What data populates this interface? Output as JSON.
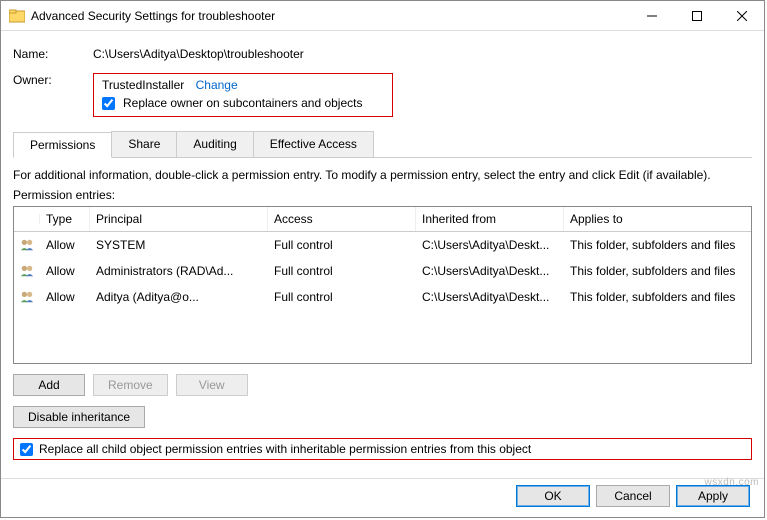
{
  "window": {
    "title": "Advanced Security Settings for troubleshooter"
  },
  "fields": {
    "nameLabel": "Name:",
    "nameValue": "C:\\Users\\Aditya\\Desktop\\troubleshooter",
    "ownerLabel": "Owner:",
    "ownerValue": "TrustedInstaller",
    "changeLink": "Change",
    "replaceOwnerCheckbox": "Replace owner on subcontainers and objects"
  },
  "tabs": {
    "permissions": "Permissions",
    "share": "Share",
    "auditing": "Auditing",
    "effective": "Effective Access"
  },
  "info": "For additional information, double-click a permission entry. To modify a permission entry, select the entry and click Edit (if available).",
  "entriesLabel": "Permission entries:",
  "headers": {
    "type": "Type",
    "principal": "Principal",
    "access": "Access",
    "inherited": "Inherited from",
    "applies": "Applies to"
  },
  "rows": [
    {
      "type": "Allow",
      "principal": "SYSTEM",
      "access": "Full control",
      "inherited": "C:\\Users\\Aditya\\Deskt...",
      "applies": "This folder, subfolders and files"
    },
    {
      "type": "Allow",
      "principal": "Administrators (RAD\\Ad...",
      "access": "Full control",
      "inherited": "C:\\Users\\Aditya\\Deskt...",
      "applies": "This folder, subfolders and files"
    },
    {
      "type": "Allow",
      "principal": "Aditya (Aditya@o...",
      "access": "Full control",
      "inherited": "C:\\Users\\Aditya\\Deskt...",
      "applies": "This folder, subfolders and files"
    }
  ],
  "buttons": {
    "add": "Add",
    "remove": "Remove",
    "view": "View",
    "disableInherit": "Disable inheritance",
    "replaceChild": "Replace all child object permission entries with inheritable permission entries from this object",
    "ok": "OK",
    "cancel": "Cancel",
    "apply": "Apply"
  },
  "watermark": "wsxdn.com"
}
